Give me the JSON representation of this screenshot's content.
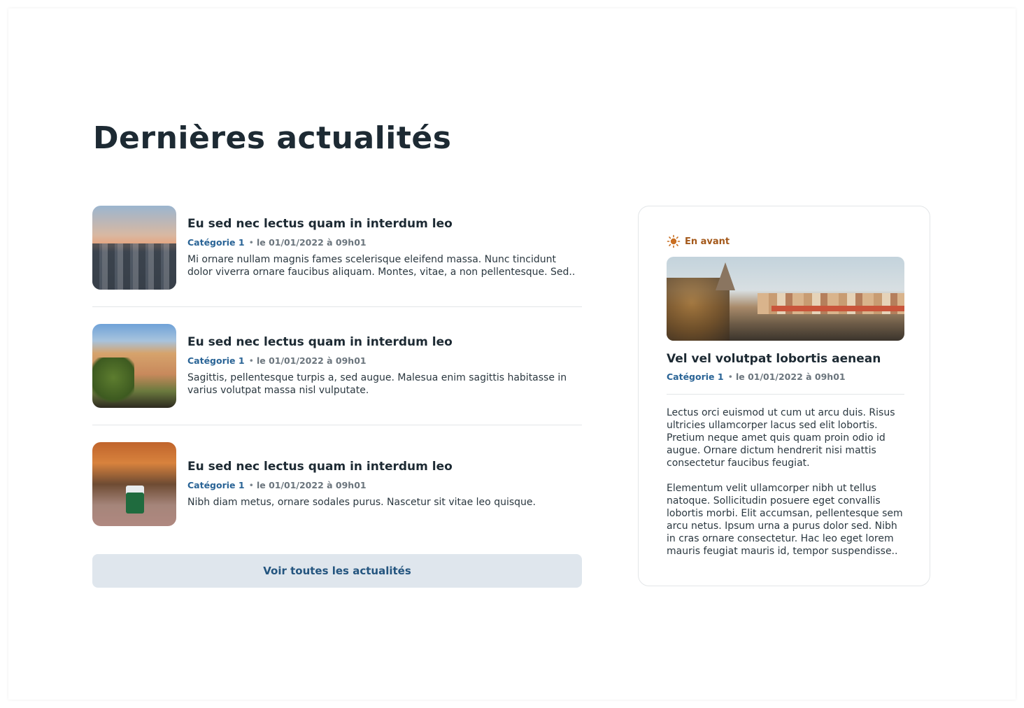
{
  "section": {
    "title": "Dernières actualités"
  },
  "news": [
    {
      "title": "Eu sed nec lectus quam in interdum leo",
      "category": "Catégorie 1",
      "date": "le 01/01/2022 à 09h01",
      "excerpt": "Mi ornare nullam magnis fames scelerisque eleifend massa. Nunc tincidunt dolor viverra ornare faucibus aliquam. Montes, vitae, a non pellentesque. Sed.."
    },
    {
      "title": "Eu sed nec lectus quam in interdum leo",
      "category": "Catégorie 1",
      "date": "le 01/01/2022 à 09h01",
      "excerpt": "Sagittis, pellentesque turpis a, sed augue. Malesua enim sagittis habitasse in varius volutpat massa nisl vulputate."
    },
    {
      "title": "Eu sed nec lectus quam in interdum leo",
      "category": "Catégorie 1",
      "date": "le 01/01/2022 à 09h01",
      "excerpt": "Nibh diam metus, ornare sodales purus. Nascetur sit vitae leo quisque."
    }
  ],
  "all_news_button": "Voir toutes les actualités",
  "featured": {
    "badge": "En avant",
    "badge_icon": "sun-icon",
    "title": "Vel vel volutpat lobortis aenean",
    "category": "Catégorie 1",
    "date": "le 01/01/2022 à 09h01",
    "paragraphs": [
      "Lectus orci euismod ut cum ut arcu duis. Risus ultricies ullamcorper lacus sed elit lobortis. Pretium neque amet quis quam proin odio id augue. Ornare dictum hendrerit nisi mattis consectetur faucibus feugiat.",
      "Elementum velit ullamcorper nibh ut tellus natoque. Sollicitudin posuere eget convallis lobortis morbi. Elit accumsan, pellentesque sem arcu netus. Ipsum urna a purus dolor sed. Nibh in cras ornare consectetur. Hac leo eget lorem mauris feugiat mauris id, tempor suspendisse.."
    ]
  },
  "colors": {
    "heading": "#1d2a33",
    "category": "#2a6496",
    "badge": "#a4591b",
    "button_bg": "#dfe6ed",
    "button_text": "#24557f"
  }
}
